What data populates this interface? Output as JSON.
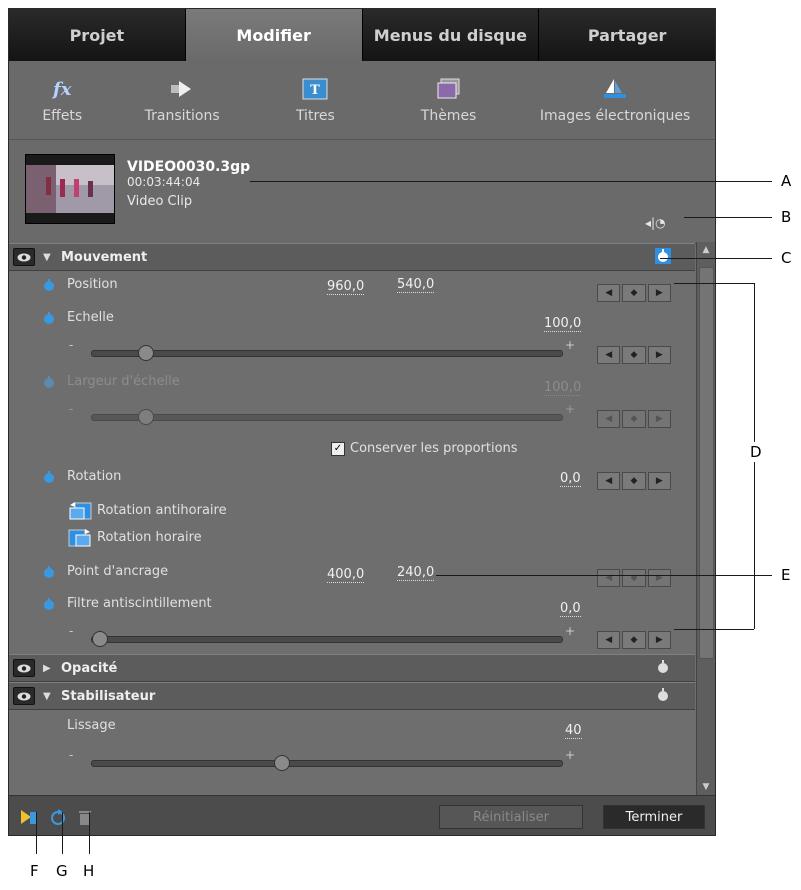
{
  "tabs": [
    {
      "label": "Projet"
    },
    {
      "label": "Modifier"
    },
    {
      "label": "Menus du disque"
    },
    {
      "label": "Partager"
    }
  ],
  "toolbar": [
    {
      "label": "Effets",
      "icon": "fx-icon"
    },
    {
      "label": "Transitions",
      "icon": "transition-arrow-icon"
    },
    {
      "label": "Titres",
      "icon": "title-icon"
    },
    {
      "label": "Thèmes",
      "icon": "theme-icon"
    },
    {
      "label": "Images électroniques",
      "icon": "sailboat-icon"
    }
  ],
  "clip": {
    "name": "VIDEO0030.3gp",
    "duration": "00:03:44:04",
    "type": "Video Clip"
  },
  "sections": {
    "motion": {
      "title": "Mouvement",
      "position_label": "Position",
      "position_x": "960,0",
      "position_y": "540,0",
      "scale_label": "Echelle",
      "scale_value": "100,0",
      "scale_slider": 0.1,
      "scale_width_label": "Largeur d'échelle",
      "scale_width_value": "100,0",
      "scale_width_slider": 0.1,
      "keep_ratio_label": "Conserver les proportions",
      "rotation_label": "Rotation",
      "rotation_value": "0,0",
      "rotate_ccw_label": "Rotation antihoraire",
      "rotate_cw_label": "Rotation horaire",
      "anchor_label": "Point d'ancrage",
      "anchor_x": "400,0",
      "anchor_y": "240,0",
      "flicker_label": "Filtre antiscintillement",
      "flicker_value": "0,0",
      "flicker_slider": 0.0
    },
    "opacity": {
      "title": "Opacité"
    },
    "stabilizer": {
      "title": "Stabilisateur",
      "smoothing_label": "Lissage",
      "smoothing_value": "40",
      "smoothing_slider": 0.4
    }
  },
  "slider_signs": {
    "minus": "-",
    "plus": "+"
  },
  "footer": {
    "reset_label": "Réinitialiser",
    "done_label": "Terminer"
  },
  "callouts": [
    "A",
    "B",
    "C",
    "D",
    "E",
    "F",
    "G",
    "H"
  ],
  "colors": {
    "panel": "#6e6e6e",
    "tab_dark": "#1e1e1e",
    "accent_blue": "#2f8fe0",
    "done_button": "#2a2a2a"
  }
}
